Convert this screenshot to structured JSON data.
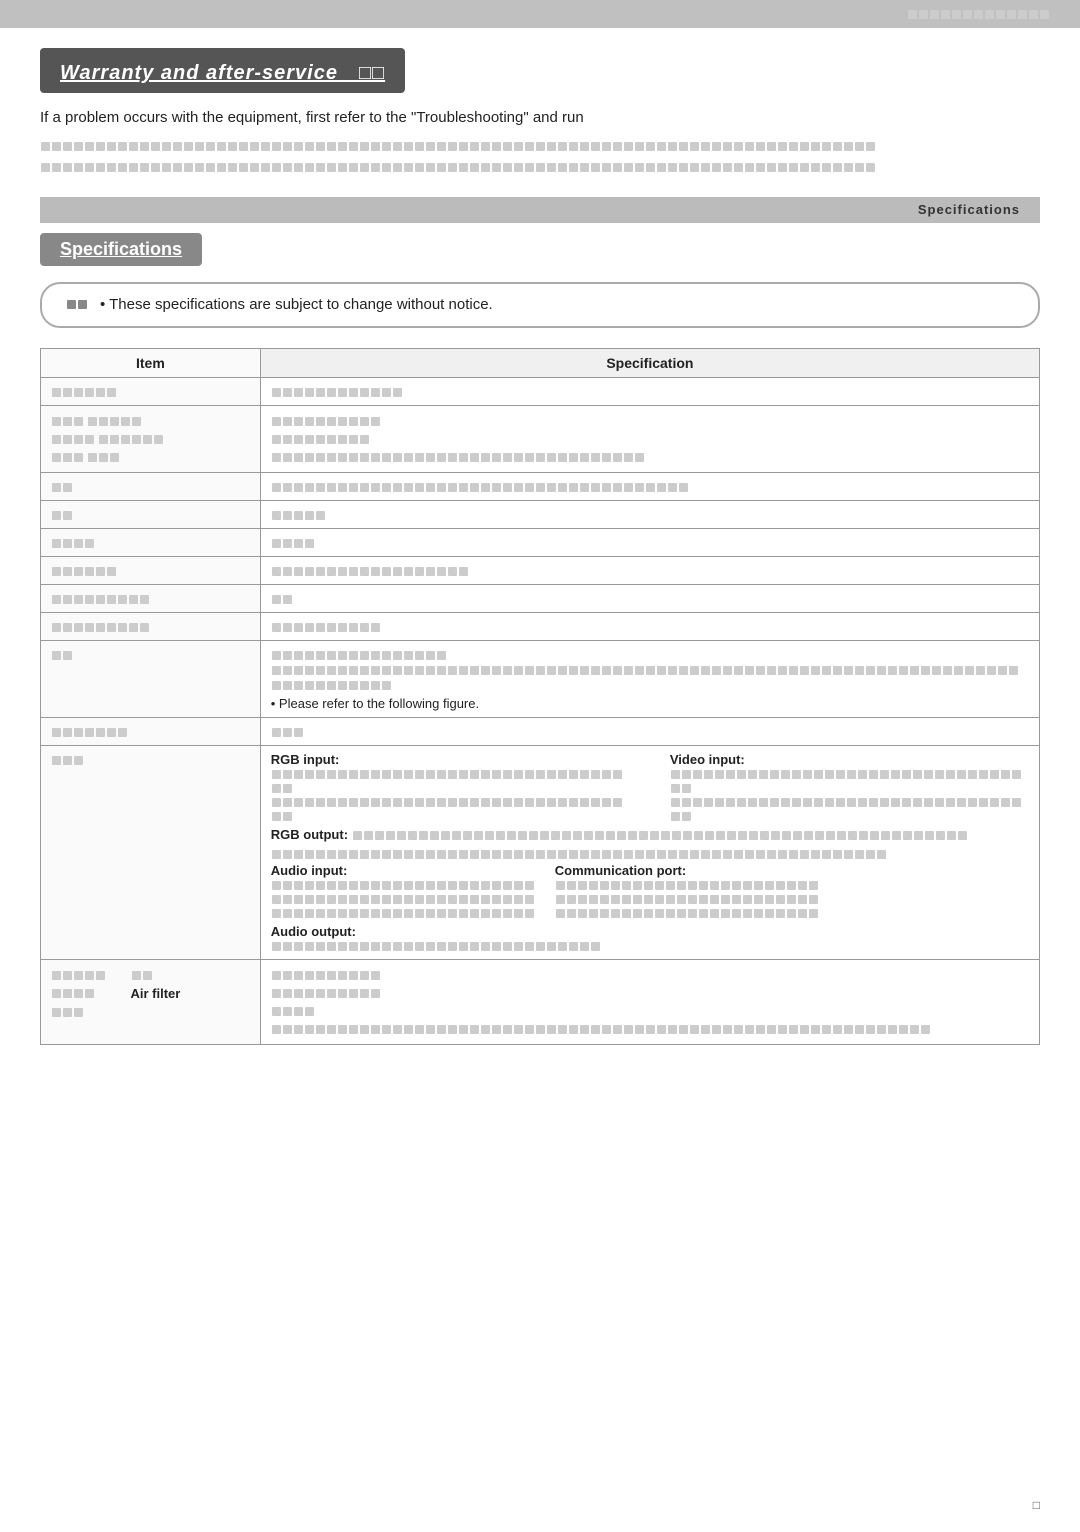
{
  "page": {
    "top_bar_text": "　　　　　　　　　　　　　　",
    "page_number": "□"
  },
  "warranty": {
    "banner_text": "Warranty and after-service　□□",
    "description": "If a problem occurs with the equipment, first refer to the \"Troubleshooting\" and run",
    "jp_line1": "□□□□□□□□□□□□□□□□□□□□□□□□□□□□□□□□□□□□□□□□□□□□□□□□□□□□□□□□□□□□□□□□□□□□□□□□□□□□",
    "jp_line2": "□□□□□□□□□□□□□□□□□□□□□□□□□□□□□□□□□□□□□□□□□□□□□□□□□□□□□□□□□□□□□□□□□□□□□□□□□□□□"
  },
  "spec_label_bar": {
    "text": "Specifications"
  },
  "specifications": {
    "banner_text": "Specifications",
    "notice": "• These specifications are subject to change without notice.",
    "notice_icon": "□□",
    "table": {
      "col_item": "Item",
      "col_spec": "Specification",
      "rows": [
        {
          "item": "□□□□□□",
          "spec": "□□□□□□□□□□□□",
          "sub_rows": null
        },
        {
          "item": "",
          "spec": "",
          "has_sub": true,
          "sub_rows": [
            {
              "label": "□□□　□□□□□",
              "spec": "□□□□□□□□□□"
            },
            {
              "label": "□□□□　□□□□□□",
              "spec": "□□□□□□□□□"
            },
            {
              "label": "□□□　□□□",
              "spec": "□□□□□□□□□□□□□□□□□□□□□□□□□□□□□□□□□□"
            }
          ]
        },
        {
          "item": "□□",
          "spec": "□□□□□□□□□□□□□□□□□□□□□□□□□□□□□□□□□□□□□□"
        },
        {
          "item": "□□",
          "spec": "□□□□□"
        },
        {
          "item": "□□□□",
          "spec": "□□□□"
        },
        {
          "item": "□□□□□□",
          "spec": "□□□□□□□□□□□□□□□□□□"
        },
        {
          "item": "□□□□□□□□□",
          "spec": "□□"
        },
        {
          "item": "□□□□□□□□□",
          "spec": "□□□□□□□□□□"
        },
        {
          "item": "□□",
          "spec": "□□□□□□□□□□□□□□□□\n□□□□□□□□□□□□□□□□□□□□□□□□□□□□□□□□□□□□□□□□□□□□□□□□□□□□□□□□□□□□□□□□□□□□□□□□□\n• Please refer to the following figure."
        },
        {
          "item": "□□□□□□□",
          "spec": "□□□"
        },
        {
          "item": "□□□",
          "spec_complex": true,
          "rgb_input_label": "RGB input:",
          "rgb_input_jp": "□□□□□□□□□□□□□□□□□□□□□□□□□□□□□□□□□□□□□□□□□□□□□□□□□□□□□□□□□□□□□□□□□□□□□□□□□□□□□□□□□□□□□□",
          "video_input_label": "Video input:",
          "video_input_jp": "□□□□□□□□□□□□□□□□□□□□□□□□□□□□□□□□□□□□□□□□□□□□□□□□□□□□□□□□□□□□□□□□□□□□□□□□□□□□□□□□□□□□□□",
          "rgb_output_label": "RGB output:",
          "rgb_output_jp": "□□□□□□□□□□□□□□□□□□□□□□□□□□□□□□□□□□□□□□□□□□□□□□□□□□□□□□□□□□□□□□□□□□□□□□□□□□□□□□□□□□□□□□",
          "audio_input_label": "Audio input:",
          "audio_input_jp": "□□□□□□□□□□□□□□□□□□□□□□□□□□□□□□□□□□□□□□□□□□□□□□□□□□□□□□□□□□□□□□□□□□□□□□□□□□□□□□□□□□□□□□",
          "comm_port_label": "Communication port:",
          "comm_port_jp": "□□□□□□□□□□□□□□□□□□□□□□□□□□□□□□□□□□□□□□□□□□□□□□□□□□□□□□□□□□□□□□□□□□□□□□□□□□□□□□□□□□□□□□",
          "audio_output_label": "Audio output:",
          "audio_output_jp": "□□□□□□□□□□□□□□□□□□□□□□□□□□□□□□□□□□□□□□□□□□□□□□□□□□□□□□□□□□□□□□□□□□□□□□□□□□□□□□□□□□□□□□"
        },
        {
          "item": "",
          "has_sub_2": true,
          "sub_label_1": "□□",
          "sub_spec_1_line1": "□□□□□□□□□□",
          "sub_spec_1_line2": "□□□□□□□□□□",
          "sub_label_2": "Air filter",
          "sub_spec_2": "□□□□",
          "sub_label_3": "□□□",
          "sub_spec_3": "□□□□□□□□□□□□□□□□□□□□□□□□□□□□□□□□□□□□□□□□□□□□□□□□□□□□□□□□□□□□□□□□□□□□□□□□□□□□□□□□□□□□□□"
        }
      ]
    }
  }
}
